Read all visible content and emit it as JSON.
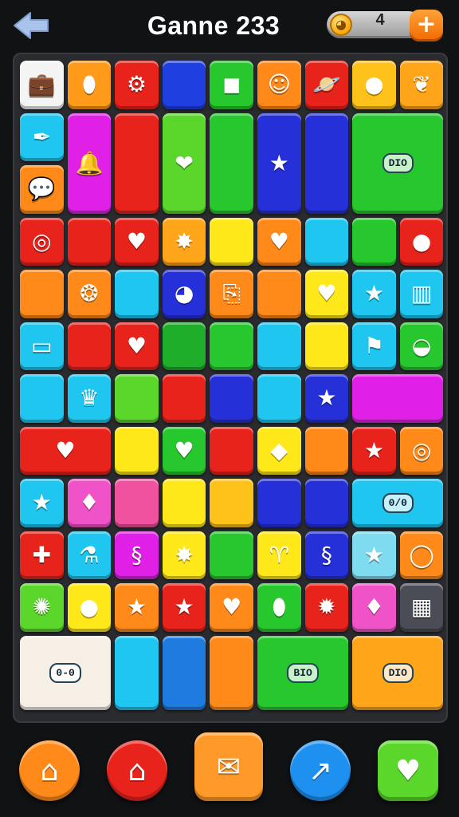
{
  "header": {
    "back_icon": "back-arrow-icon",
    "title": "Ganne 233",
    "coins": "4",
    "coin_icon": "coin-icon",
    "add_icon": "plus-icon"
  },
  "colors": {
    "background": "#111214",
    "board": "#2a2b2f"
  },
  "tiles": [
    {
      "r": 0,
      "c": 0,
      "w": 1,
      "h": 1,
      "color": "#f4f4f4",
      "icon": "suitcase-icon",
      "glyph": "💼"
    },
    {
      "r": 0,
      "c": 1,
      "w": 1,
      "h": 1,
      "color": "#ff9a1a",
      "icon": "teal-gem-icon",
      "glyph": "⬮"
    },
    {
      "r": 0,
      "c": 2,
      "w": 1,
      "h": 1,
      "color": "#e8231c",
      "icon": "gear-icon",
      "glyph": "⚙"
    },
    {
      "r": 0,
      "c": 3,
      "w": 1,
      "h": 1,
      "color": "#1f3fe0",
      "icon": "",
      "glyph": ""
    },
    {
      "r": 0,
      "c": 4,
      "w": 1,
      "h": 1,
      "color": "#27c82e",
      "icon": "blue-square-icon",
      "glyph": "◼"
    },
    {
      "r": 0,
      "c": 5,
      "w": 1,
      "h": 1,
      "color": "#ff8a1a",
      "icon": "face-icon",
      "glyph": "☺"
    },
    {
      "r": 0,
      "c": 6,
      "w": 1,
      "h": 1,
      "color": "#e8231c",
      "icon": "planet-icon",
      "glyph": "🪐"
    },
    {
      "r": 0,
      "c": 7,
      "w": 1,
      "h": 1,
      "color": "#ffc21a",
      "icon": "orange-ball-icon",
      "glyph": "●"
    },
    {
      "r": 0,
      "c": 8,
      "w": 1,
      "h": 1,
      "color": "#ffa51a",
      "icon": "leaf-creature-icon",
      "glyph": "❦"
    },
    {
      "r": 1,
      "c": 0,
      "w": 1,
      "h": 1,
      "color": "#1ec6f0",
      "icon": "feather-icon",
      "glyph": "✒"
    },
    {
      "r": 1,
      "c": 1,
      "w": 1,
      "h": 2,
      "color": "#e020e6",
      "icon": "bell-icon",
      "glyph": "🔔"
    },
    {
      "r": 1,
      "c": 2,
      "w": 1,
      "h": 2,
      "color": "#e8231c",
      "icon": "",
      "glyph": ""
    },
    {
      "r": 1,
      "c": 3,
      "w": 1,
      "h": 2,
      "color": "#5bd62a",
      "icon": "heart-icon",
      "glyph": "❤"
    },
    {
      "r": 1,
      "c": 4,
      "w": 1,
      "h": 2,
      "color": "#27c82e",
      "icon": "",
      "glyph": ""
    },
    {
      "r": 1,
      "c": 5,
      "w": 1,
      "h": 2,
      "color": "#2530d8",
      "icon": "star-icon",
      "glyph": "★"
    },
    {
      "r": 1,
      "c": 6,
      "w": 1,
      "h": 2,
      "color": "#2530d8",
      "icon": "",
      "glyph": ""
    },
    {
      "r": 1,
      "c": 7,
      "w": 2,
      "h": 2,
      "color": "#27c82e",
      "icon": "rocket-badge-icon",
      "label": "DIO"
    },
    {
      "r": 2,
      "c": 0,
      "w": 1,
      "h": 1,
      "color": "#ff8a1a",
      "icon": "speech-bubble-icon",
      "glyph": "💬"
    },
    {
      "r": 3,
      "c": 0,
      "w": 1,
      "h": 1,
      "color": "#e8231c",
      "icon": "target-icon",
      "glyph": "◎"
    },
    {
      "r": 3,
      "c": 1,
      "w": 1,
      "h": 1,
      "color": "#e8231c",
      "icon": "",
      "glyph": ""
    },
    {
      "r": 3,
      "c": 2,
      "w": 1,
      "h": 1,
      "color": "#e8231c",
      "icon": "pink-heart-icon",
      "glyph": "♥"
    },
    {
      "r": 3,
      "c": 3,
      "w": 1,
      "h": 1,
      "color": "#ffa51a",
      "icon": "burst-icon",
      "glyph": "✸"
    },
    {
      "r": 3,
      "c": 4,
      "w": 1,
      "h": 1,
      "color": "#ffe81a",
      "icon": "",
      "glyph": ""
    },
    {
      "r": 3,
      "c": 5,
      "w": 1,
      "h": 1,
      "color": "#ff8a1a",
      "icon": "pink-heart-icon",
      "glyph": "♥"
    },
    {
      "r": 3,
      "c": 6,
      "w": 1,
      "h": 1,
      "color": "#1ec6f0",
      "icon": "",
      "glyph": ""
    },
    {
      "r": 3,
      "c": 7,
      "w": 1,
      "h": 1,
      "color": "#27c82e",
      "icon": "",
      "glyph": ""
    },
    {
      "r": 3,
      "c": 8,
      "w": 1,
      "h": 1,
      "color": "#e8231c",
      "icon": "orange-icon",
      "glyph": "●"
    },
    {
      "r": 4,
      "c": 0,
      "w": 1,
      "h": 1,
      "color": "#ff8a1a",
      "icon": "",
      "glyph": ""
    },
    {
      "r": 4,
      "c": 1,
      "w": 1,
      "h": 1,
      "color": "#ff8a1a",
      "icon": "drop-icon",
      "glyph": "❂"
    },
    {
      "r": 4,
      "c": 2,
      "w": 1,
      "h": 1,
      "color": "#1ec6f0",
      "icon": "",
      "glyph": ""
    },
    {
      "r": 4,
      "c": 3,
      "w": 1,
      "h": 1,
      "color": "#2530d8",
      "icon": "ornament-icon",
      "glyph": "◕"
    },
    {
      "r": 4,
      "c": 4,
      "w": 1,
      "h": 1,
      "color": "#ff8a1a",
      "icon": "scroll-icon",
      "glyph": "⎘"
    },
    {
      "r": 4,
      "c": 5,
      "w": 1,
      "h": 1,
      "color": "#ff8a1a",
      "icon": "",
      "glyph": ""
    },
    {
      "r": 4,
      "c": 6,
      "w": 1,
      "h": 1,
      "color": "#ffe81a",
      "icon": "teal-heart-icon",
      "glyph": "♥"
    },
    {
      "r": 4,
      "c": 7,
      "w": 1,
      "h": 1,
      "color": "#1ec6f0",
      "icon": "pink-star-icon",
      "glyph": "★"
    },
    {
      "r": 4,
      "c": 8,
      "w": 1,
      "h": 1,
      "color": "#1ec6f0",
      "icon": "striped-box-icon",
      "glyph": "▥"
    },
    {
      "r": 5,
      "c": 0,
      "w": 1,
      "h": 1,
      "color": "#1ec6f0",
      "icon": "battery-icon",
      "glyph": "▭"
    },
    {
      "r": 5,
      "c": 1,
      "w": 1,
      "h": 1,
      "color": "#e8231c",
      "icon": "",
      "glyph": ""
    },
    {
      "r": 5,
      "c": 2,
      "w": 1,
      "h": 1,
      "color": "#e8231c",
      "icon": "heart-icon",
      "glyph": "♥"
    },
    {
      "r": 5,
      "c": 3,
      "w": 1,
      "h": 1,
      "color": "#1fae2a",
      "icon": "",
      "glyph": ""
    },
    {
      "r": 5,
      "c": 4,
      "w": 1,
      "h": 1,
      "color": "#27c82e",
      "icon": "",
      "glyph": ""
    },
    {
      "r": 5,
      "c": 5,
      "w": 1,
      "h": 1,
      "color": "#1ec6f0",
      "icon": "",
      "glyph": ""
    },
    {
      "r": 5,
      "c": 6,
      "w": 1,
      "h": 1,
      "color": "#ffe81a",
      "icon": "",
      "glyph": ""
    },
    {
      "r": 5,
      "c": 7,
      "w": 1,
      "h": 1,
      "color": "#1ec6f0",
      "icon": "flag-icon",
      "glyph": "⚑"
    },
    {
      "r": 5,
      "c": 8,
      "w": 1,
      "h": 1,
      "color": "#27c82e",
      "icon": "striped-ball-icon",
      "glyph": "◒"
    },
    {
      "r": 6,
      "c": 0,
      "w": 1,
      "h": 1,
      "color": "#1ec6f0",
      "icon": "",
      "glyph": ""
    },
    {
      "r": 6,
      "c": 1,
      "w": 1,
      "h": 1,
      "color": "#1ec6f0",
      "icon": "crown-icon",
      "glyph": "♛"
    },
    {
      "r": 6,
      "c": 2,
      "w": 1,
      "h": 1,
      "color": "#5bd62a",
      "icon": "",
      "glyph": ""
    },
    {
      "r": 6,
      "c": 3,
      "w": 1,
      "h": 1,
      "color": "#e8231c",
      "icon": "",
      "glyph": ""
    },
    {
      "r": 6,
      "c": 4,
      "w": 1,
      "h": 1,
      "color": "#2530d8",
      "icon": "",
      "glyph": ""
    },
    {
      "r": 6,
      "c": 5,
      "w": 1,
      "h": 1,
      "color": "#1ec6f0",
      "icon": "",
      "glyph": ""
    },
    {
      "r": 6,
      "c": 6,
      "w": 1,
      "h": 1,
      "color": "#2530d8",
      "icon": "star-icon",
      "glyph": "★"
    },
    {
      "r": 6,
      "c": 7,
      "w": 2,
      "h": 1,
      "color": "#e020e6",
      "icon": "",
      "glyph": ""
    },
    {
      "r": 7,
      "c": 0,
      "w": 2,
      "h": 1,
      "color": "#e8231c",
      "icon": "heart-icon",
      "glyph": "♥"
    },
    {
      "r": 7,
      "c": 2,
      "w": 1,
      "h": 1,
      "color": "#ffe81a",
      "icon": "",
      "glyph": ""
    },
    {
      "r": 7,
      "c": 3,
      "w": 1,
      "h": 1,
      "color": "#27c82e",
      "icon": "orange-heart-icon",
      "glyph": "♥"
    },
    {
      "r": 7,
      "c": 4,
      "w": 1,
      "h": 1,
      "color": "#e8231c",
      "icon": "",
      "glyph": ""
    },
    {
      "r": 7,
      "c": 5,
      "w": 1,
      "h": 1,
      "color": "#ffe81a",
      "icon": "crystal-icon",
      "glyph": "◆"
    },
    {
      "r": 7,
      "c": 6,
      "w": 1,
      "h": 1,
      "color": "#ff8a1a",
      "icon": "",
      "glyph": ""
    },
    {
      "r": 7,
      "c": 7,
      "w": 1,
      "h": 1,
      "color": "#e8231c",
      "icon": "star-icon",
      "glyph": "★"
    },
    {
      "r": 7,
      "c": 8,
      "w": 1,
      "h": 1,
      "color": "#ff8a1a",
      "icon": "spiral-icon",
      "glyph": "◎"
    },
    {
      "r": 8,
      "c": 0,
      "w": 1,
      "h": 1,
      "color": "#1ec6f0",
      "icon": "pink-star-icon",
      "glyph": "★"
    },
    {
      "r": 8,
      "c": 1,
      "w": 1,
      "h": 1,
      "color": "#f052c8",
      "icon": "diamond-icon",
      "glyph": "♦"
    },
    {
      "r": 8,
      "c": 2,
      "w": 1,
      "h": 1,
      "color": "#f052a0",
      "icon": "",
      "glyph": ""
    },
    {
      "r": 8,
      "c": 3,
      "w": 1,
      "h": 1,
      "color": "#ffe81a",
      "icon": "",
      "glyph": ""
    },
    {
      "r": 8,
      "c": 4,
      "w": 1,
      "h": 1,
      "color": "#ffc21a",
      "icon": "",
      "glyph": ""
    },
    {
      "r": 8,
      "c": 5,
      "w": 1,
      "h": 1,
      "color": "#2530d8",
      "icon": "",
      "glyph": ""
    },
    {
      "r": 8,
      "c": 6,
      "w": 1,
      "h": 1,
      "color": "#2530d8",
      "icon": "",
      "glyph": ""
    },
    {
      "r": 8,
      "c": 7,
      "w": 2,
      "h": 1,
      "color": "#1ec6f0",
      "icon": "capsule-icon",
      "label": "0/0"
    },
    {
      "r": 9,
      "c": 0,
      "w": 1,
      "h": 1,
      "color": "#e8231c",
      "icon": "puzzle-icon",
      "glyph": "✚"
    },
    {
      "r": 9,
      "c": 1,
      "w": 1,
      "h": 1,
      "color": "#1ec6f0",
      "icon": "bottle-icon",
      "glyph": "⚗"
    },
    {
      "r": 9,
      "c": 2,
      "w": 1,
      "h": 1,
      "color": "#e020e6",
      "icon": "swirl-icon",
      "glyph": "§"
    },
    {
      "r": 9,
      "c": 3,
      "w": 1,
      "h": 1,
      "color": "#ffe81a",
      "icon": "orange-star-icon",
      "glyph": "✸"
    },
    {
      "r": 9,
      "c": 4,
      "w": 1,
      "h": 1,
      "color": "#27c82e",
      "icon": "",
      "glyph": ""
    },
    {
      "r": 9,
      "c": 5,
      "w": 1,
      "h": 1,
      "color": "#ffe81a",
      "icon": "horn-icon",
      "glyph": "♈"
    },
    {
      "r": 9,
      "c": 6,
      "w": 1,
      "h": 1,
      "color": "#2530d8",
      "icon": "swirl-icon",
      "glyph": "§"
    },
    {
      "r": 9,
      "c": 7,
      "w": 1,
      "h": 1,
      "color": "#7fdcf0",
      "icon": "green-star-icon",
      "glyph": "★"
    },
    {
      "r": 9,
      "c": 8,
      "w": 1,
      "h": 1,
      "color": "#ff8a1a",
      "icon": "ring-icon",
      "glyph": "◯"
    },
    {
      "r": 10,
      "c": 0,
      "w": 1,
      "h": 1,
      "color": "#5bd62a",
      "icon": "green-cog-icon",
      "glyph": "✺"
    },
    {
      "r": 10,
      "c": 1,
      "w": 1,
      "h": 1,
      "color": "#ffe81a",
      "icon": "orange-ball-icon",
      "glyph": "●"
    },
    {
      "r": 10,
      "c": 2,
      "w": 1,
      "h": 1,
      "color": "#ff8a1a",
      "icon": "star-icon",
      "glyph": "★"
    },
    {
      "r": 10,
      "c": 3,
      "w": 1,
      "h": 1,
      "color": "#e8231c",
      "icon": "star-icon",
      "glyph": "★"
    },
    {
      "r": 10,
      "c": 4,
      "w": 1,
      "h": 1,
      "color": "#ff8a1a",
      "icon": "teal-heart-icon",
      "glyph": "♥"
    },
    {
      "r": 10,
      "c": 5,
      "w": 1,
      "h": 1,
      "color": "#27c82e",
      "icon": "green-drop-icon",
      "glyph": "⬮"
    },
    {
      "r": 10,
      "c": 6,
      "w": 1,
      "h": 1,
      "color": "#e8231c",
      "icon": "crab-icon",
      "glyph": "✹"
    },
    {
      "r": 10,
      "c": 7,
      "w": 1,
      "h": 1,
      "color": "#f052c8",
      "icon": "diamond-icon",
      "glyph": "♦"
    },
    {
      "r": 10,
      "c": 8,
      "w": 1,
      "h": 1,
      "color": "#4a4d55",
      "icon": "grid-icon",
      "glyph": "▦"
    },
    {
      "r": 11,
      "c": 0,
      "w": 2,
      "h": 1.5,
      "color": "#f6efe6",
      "icon": "star-badge-icon",
      "label": "0-0"
    },
    {
      "r": 11,
      "c": 2,
      "w": 1,
      "h": 1.5,
      "color": "#1ec6f0",
      "icon": "",
      "glyph": ""
    },
    {
      "r": 11,
      "c": 3,
      "w": 1,
      "h": 1.5,
      "color": "#1f7be0",
      "icon": "",
      "glyph": ""
    },
    {
      "r": 11,
      "c": 4,
      "w": 1,
      "h": 1.5,
      "color": "#ff8a1a",
      "icon": "",
      "glyph": ""
    },
    {
      "r": 11,
      "c": 5,
      "w": 2,
      "h": 1.5,
      "color": "#27c82e",
      "icon": "ufo-badge-icon",
      "label": "BIO"
    },
    {
      "r": 11,
      "c": 7,
      "w": 2,
      "h": 1.5,
      "color": "#ffa51a",
      "icon": "ornate-badge-icon",
      "label": "DIO"
    }
  ],
  "nav": [
    {
      "name": "home-nav-button",
      "icon": "house-icon",
      "glyph": "⌂",
      "bg": "#ff8a1a",
      "radius": "50%"
    },
    {
      "name": "home-alt-nav-button",
      "icon": "house-icon",
      "glyph": "⌂",
      "bg": "#e8231c",
      "radius": "50%"
    },
    {
      "name": "mail-nav-button",
      "icon": "envelope-icon",
      "glyph": "✉",
      "bg": "#ff9a2a",
      "radius": "16px"
    },
    {
      "name": "stats-nav-button",
      "icon": "chart-icon",
      "glyph": "↗",
      "bg": "#1e90f0",
      "radius": "50%"
    },
    {
      "name": "favorite-nav-button",
      "icon": "heart-chat-icon",
      "glyph": "♥",
      "bg": "#5bd62a",
      "radius": "16px"
    }
  ]
}
